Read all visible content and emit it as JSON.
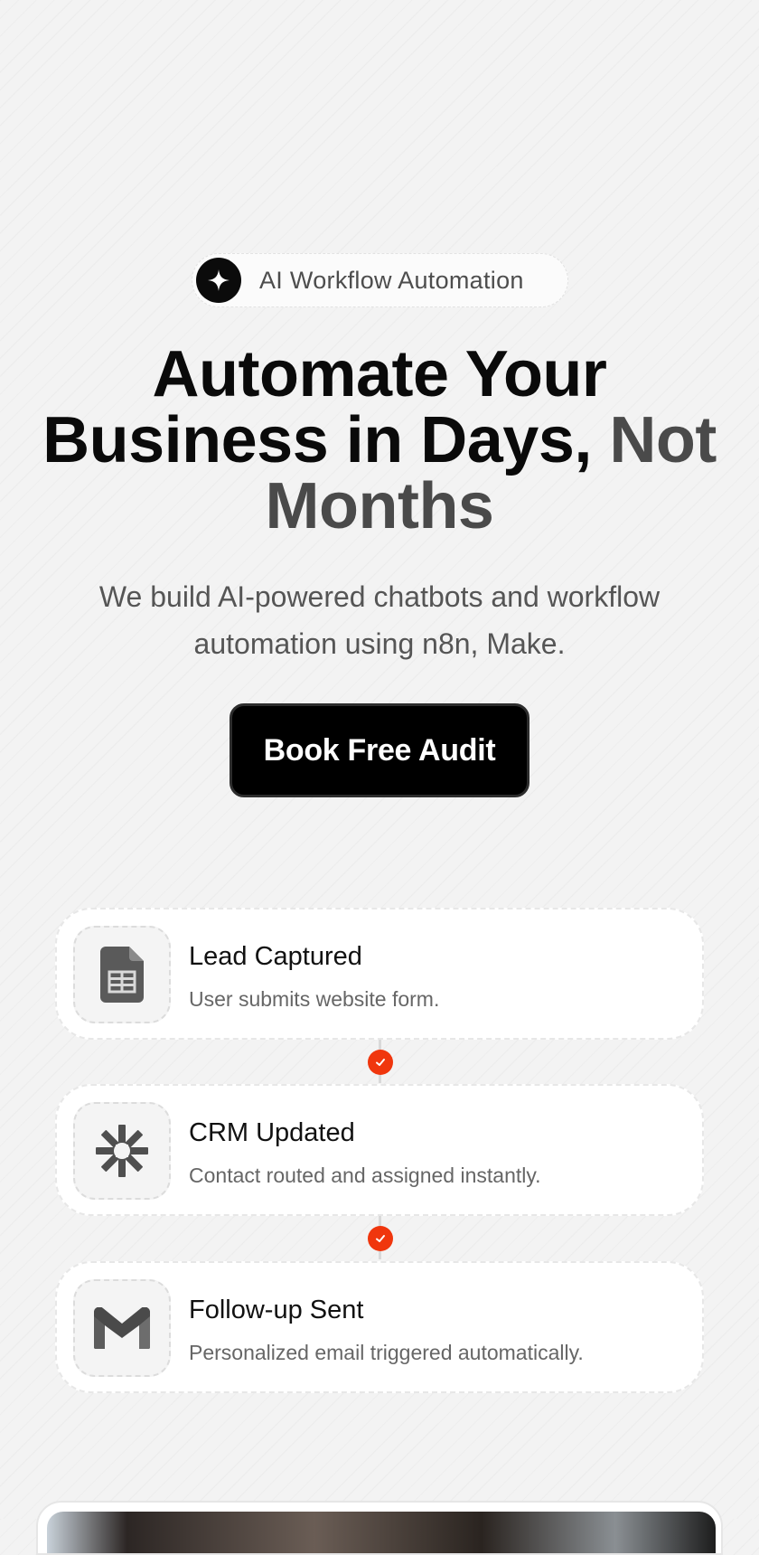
{
  "badge": {
    "icon": "sparkle-icon",
    "label": "AI Workflow Automation"
  },
  "hero": {
    "title_main": "Automate Your Business in Days,",
    "title_muted": "Not Months",
    "subtitle": "We build AI-powered chatbots and workflow automation using n8n, Make.",
    "cta_label": "Book Free Audit"
  },
  "workflow": {
    "steps": [
      {
        "icon": "google-sheets-icon",
        "title": "Lead Captured",
        "description": "User submits website form."
      },
      {
        "icon": "zapier-asterisk-icon",
        "title": "CRM Updated",
        "description": "Contact routed and assigned instantly."
      },
      {
        "icon": "gmail-icon",
        "title": "Follow-up Sent",
        "description": "Personalized email triggered automatically."
      }
    ],
    "connector_icon": "check-icon",
    "accent_color": "#f0360d"
  }
}
